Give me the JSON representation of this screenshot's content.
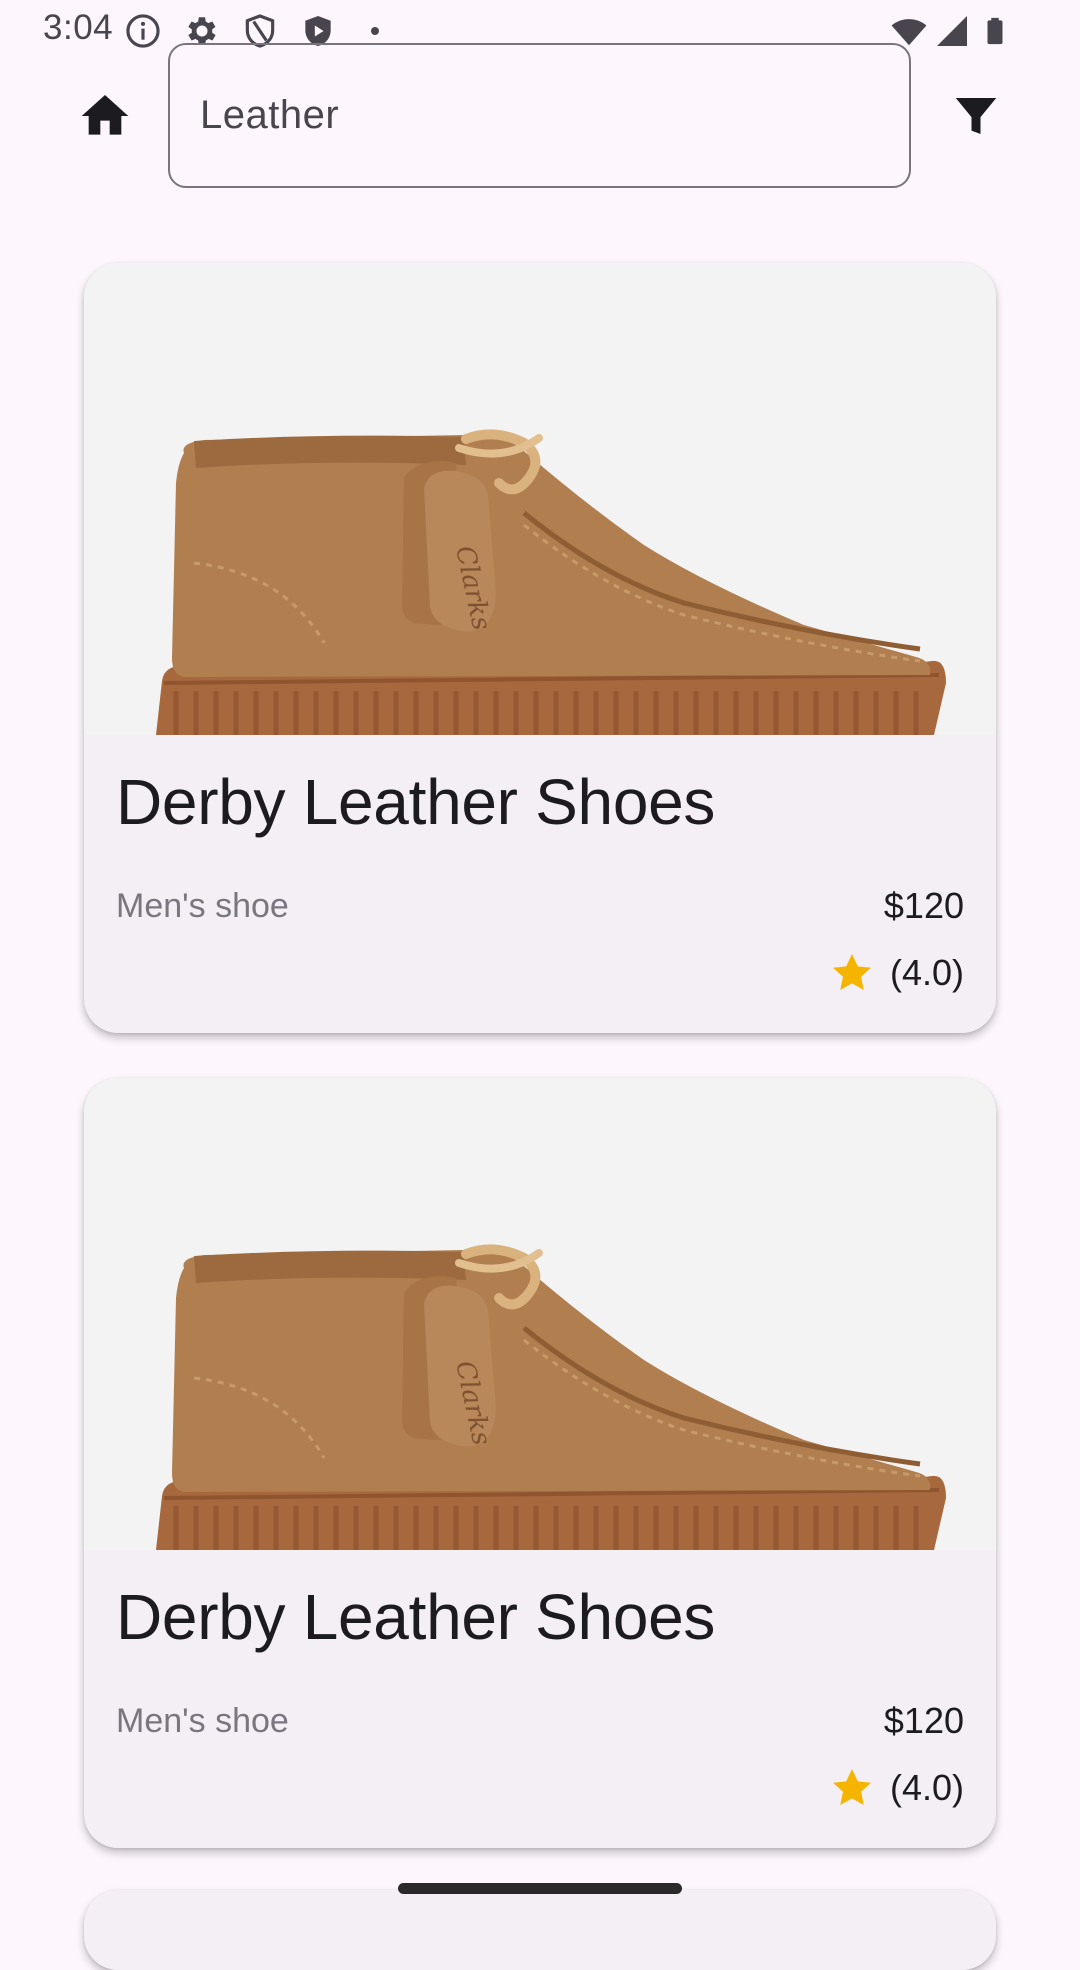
{
  "status_bar": {
    "time": "3:04",
    "icons": [
      "info-icon",
      "settings-icon",
      "shield-icon",
      "play-shield-icon",
      "dot-icon",
      "wifi-icon",
      "signal-icon",
      "battery-icon"
    ]
  },
  "top_bar": {
    "home_icon": "home-icon",
    "search_value": "Leather",
    "filter_icon": "filter-icon"
  },
  "products": [
    {
      "title": "Derby Leather Shoes",
      "subtitle": "Men's shoe",
      "price": "$120",
      "rating_text": "(4.0)",
      "rating": 4.0
    },
    {
      "title": "Derby Leather Shoes",
      "subtitle": "Men's shoe",
      "price": "$120",
      "rating_text": "(4.0)",
      "rating": 4.0
    }
  ],
  "colors": {
    "background": "#FDF7FD",
    "card": "#F4EFF4",
    "star": "#F4B400",
    "shoe": "#B07E4F"
  }
}
